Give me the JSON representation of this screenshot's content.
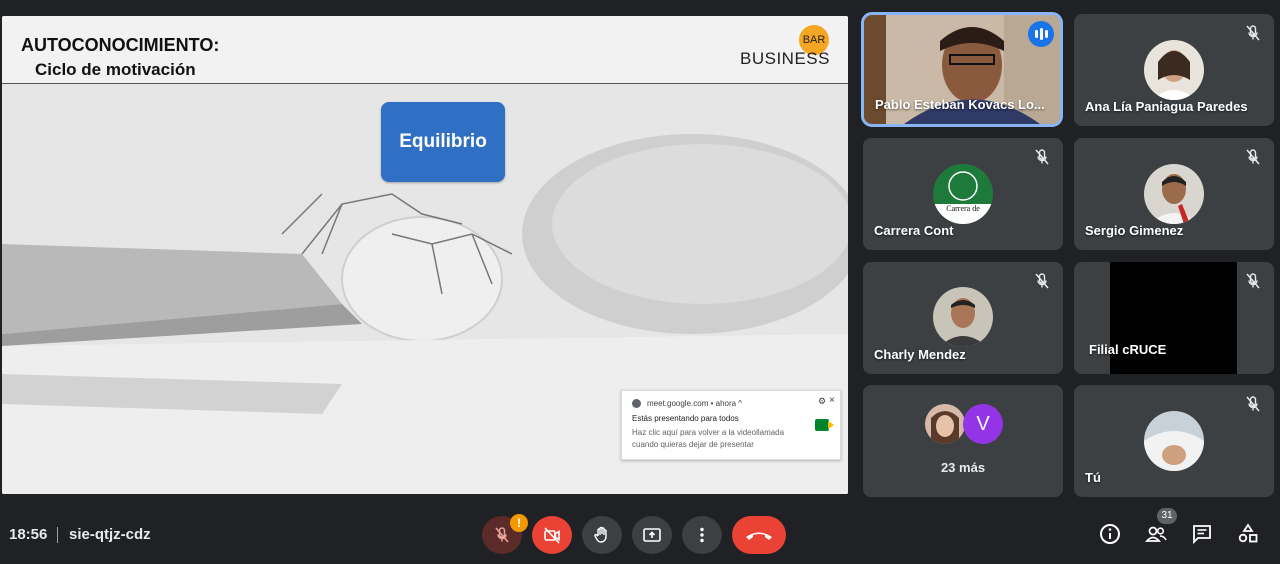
{
  "slide": {
    "title": "AUTOCONOCIMIENTO:",
    "subtitle": "Ciclo de motivación",
    "logo_text": "BUSINESS",
    "logo_badge": "BAR",
    "box_label": "Equilibrio"
  },
  "notification": {
    "source": "meet.google.com • ahora ^",
    "title": "Estás presentando para todos",
    "body": "Haz clic aquí para volver a la videollamada cuando quieras dejar de presentar"
  },
  "participants": [
    {
      "name": "Pablo Esteban Kovacs Lo...",
      "speaking": true
    },
    {
      "name": "Ana Lía Paniagua Paredes",
      "muted": true
    },
    {
      "name": "Carrera Cont",
      "muted": true,
      "avatar_text": "Carrera de"
    },
    {
      "name": "Sergio Gimenez",
      "muted": true
    },
    {
      "name": "Charly Mendez",
      "muted": true
    },
    {
      "name": "Filial cRUCE",
      "muted": true
    },
    {
      "name": "23 más",
      "avatar_letter": "V"
    },
    {
      "name": "Tú",
      "muted": true
    }
  ],
  "meeting": {
    "time": "18:56",
    "code": "sie-qtjz-cdz",
    "warning_badge": "!",
    "people_count": "31"
  },
  "colors": {
    "accent_blue": "#1a73e8",
    "end_call_red": "#ea4335",
    "slide_box_blue": "#2f6fc4",
    "logo_orange": "#f5a623"
  }
}
